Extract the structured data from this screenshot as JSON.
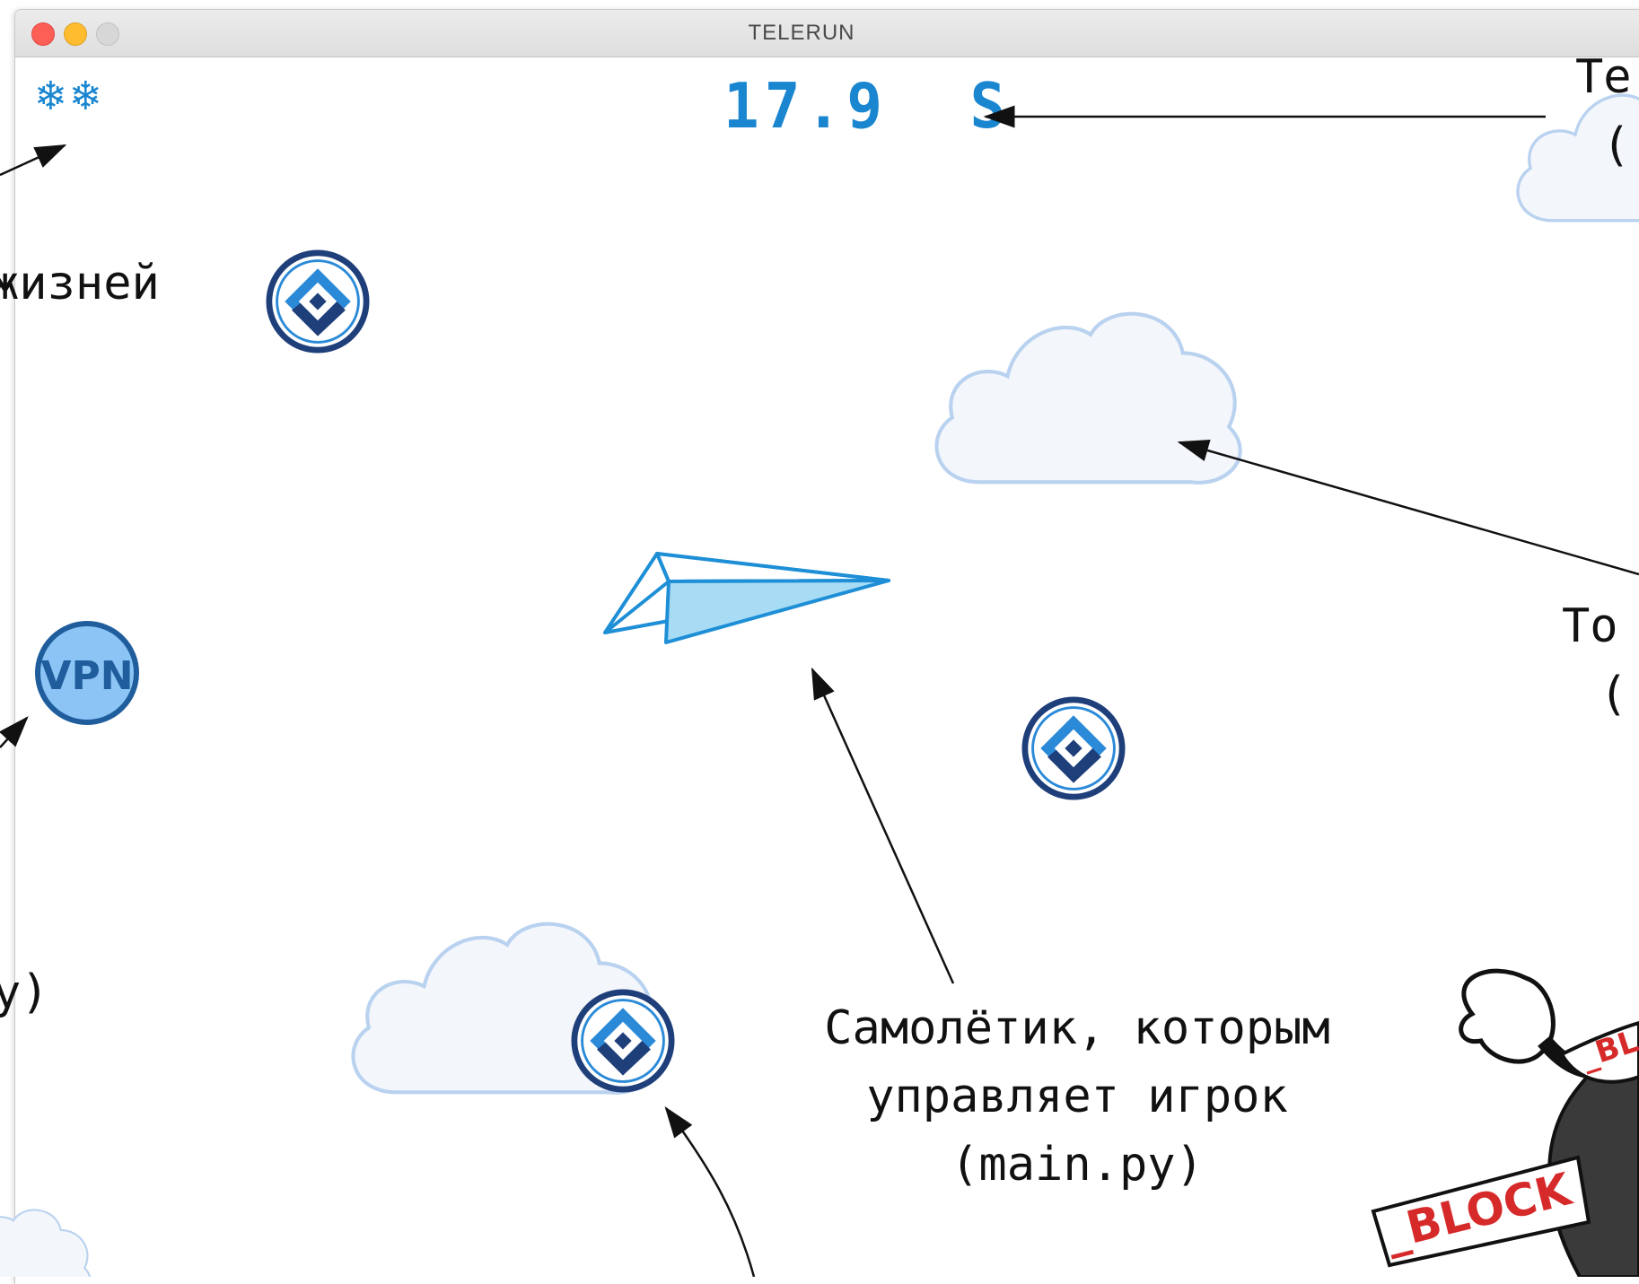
{
  "window": {
    "title": "TELERUN"
  },
  "hud": {
    "lives_icon": "snowflake-icon",
    "lives_glyph": "❄",
    "lives_count": 2,
    "timer_value": "17.9",
    "timer_unit": "S"
  },
  "sprites": {
    "blocker_icon": "roskomnadzor-logo-icon",
    "vpn_label": "VPN",
    "block_label_top": "_BL",
    "block_label_bottom": "_BLOCK"
  },
  "annotations": {
    "player_line1": "Самолётик, которым",
    "player_line2": "управляет игрок",
    "player_line3": "(main.py)",
    "lives_fragment": "жизней",
    "left_paren_fragment": "y)",
    "timer_fragment_line1": "Te",
    "timer_fragment_line2": "(",
    "cloud_fragment_line1": "To",
    "cloud_fragment_line2": "("
  },
  "colors": {
    "accent": "#1a86d0",
    "cloud_fill": "#f3f6fb",
    "cloud_stroke": "#b9d2ef",
    "plane_stroke": "#1e8fd6",
    "plane_light": "#a8dcf5",
    "vpn_fill": "#8cc5f5",
    "vpn_stroke": "#1f5d9c",
    "badge_dark": "#1f3f7a",
    "badge_light": "#2b8ad8"
  }
}
